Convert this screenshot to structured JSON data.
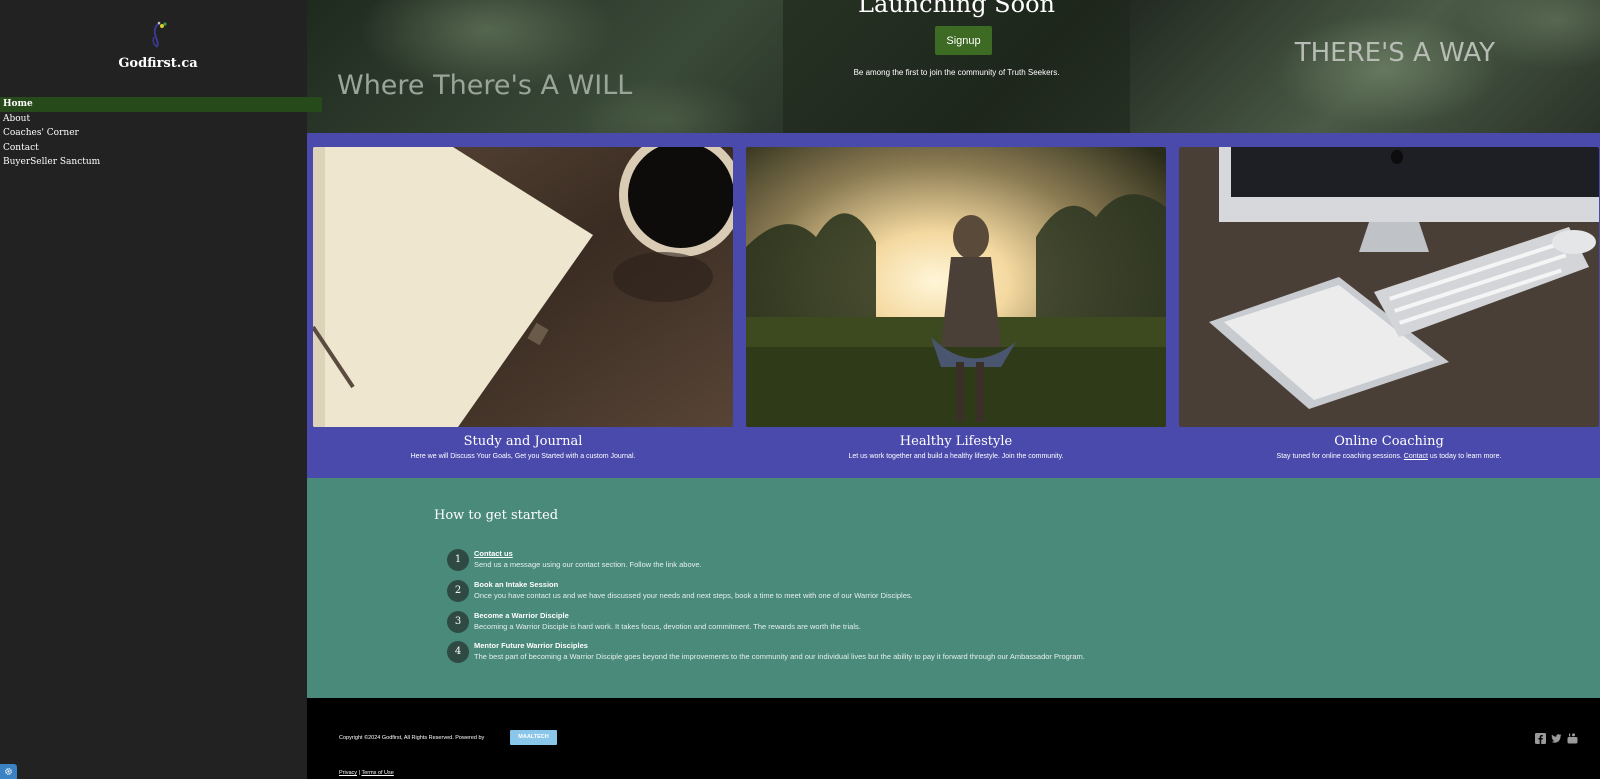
{
  "sidebar": {
    "site_name": "Godfirst.ca",
    "nav": [
      {
        "label": "Home",
        "active": true
      },
      {
        "label": "About",
        "active": false
      },
      {
        "label": "Coaches' Corner",
        "active": false
      },
      {
        "label": "Contact",
        "active": false
      },
      {
        "label": "BuyerSeller Sanctum",
        "active": false
      }
    ],
    "settings_icon": "gear-icon"
  },
  "hero": {
    "left_text": "Where There's A WILL",
    "title": "Launching Soon",
    "signup_label": "Signup",
    "subtitle": "Be among the first to join the community of Truth Seekers.",
    "right_text": "THERE'S A WAY"
  },
  "features": [
    {
      "title": "Study and Journal",
      "desc": "Here we will Discuss Your Goals, Get you Started with a custom Journal.",
      "image": "notebook-and-coffee"
    },
    {
      "title": "Healthy Lifestyle",
      "desc": "Let us work together and build a healthy lifestyle. Join the community.",
      "image": "woman-in-sunlit-field"
    },
    {
      "title": "Online Coaching",
      "desc_before": "Stay tuned for online coaching sessions.",
      "desc_link": "Contact",
      "desc_after": "us today to learn more.",
      "image": "computer-tablet-keyboard"
    }
  ],
  "steps": {
    "heading": "How to get started",
    "items": [
      {
        "num": "1",
        "title": "Contact us",
        "desc": "Send us a message using our contact section. Follow the link above."
      },
      {
        "num": "2",
        "title": "Book an Intake Session",
        "desc": "Once you have contact us and we have discussed your needs and next steps, book a time to meet with one of our Warrior Disciples."
      },
      {
        "num": "3",
        "title": "Become a Warrior Disciple",
        "desc": "Becoming a Warrior Disciple is hard work. It takes focus, devotion and commitment. The rewards are worth the trials."
      },
      {
        "num": "4",
        "title": "Mentor Future Warrior Disciples",
        "desc": "The best part of becoming a Warrior Disciple goes beyond the improvements to the community and our individual lives but the ability to pay it forward through our Ambassador Program."
      }
    ]
  },
  "footer": {
    "copyright": "Copyright ©2024 Godfirst, All Rights Reserved. Powered by",
    "powered_by": "MAALTECH",
    "privacy": "Privacy",
    "separator": "|",
    "terms": "Terms of Use",
    "social_icons": [
      "facebook-icon",
      "twitter-icon",
      "youtube-icon"
    ]
  },
  "colors": {
    "sidebar_bg": "#222222",
    "nav_active": "#274a1b",
    "signup_button": "#3d6b23",
    "features_bg": "#4a4aac",
    "steps_bg": "#4a8a7a",
    "step_circle": "#2f4a42",
    "footer_bg": "#000000",
    "powered_badge": "#8ac6ea"
  }
}
